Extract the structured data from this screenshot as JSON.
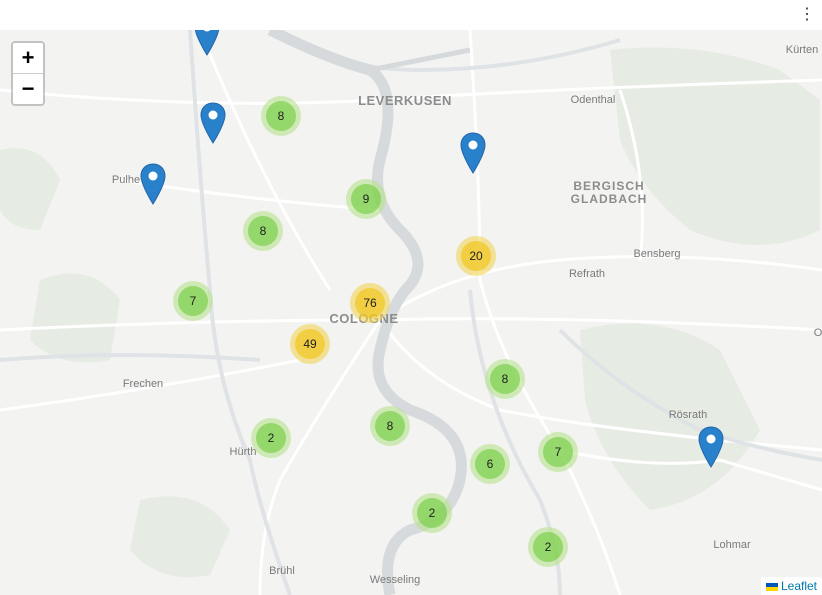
{
  "header": {
    "menu_icon": "vertical-ellipsis-icon",
    "menu_glyph": "⋮"
  },
  "map": {
    "zoom_in": "+",
    "zoom_out": "−",
    "attribution": "Leaflet",
    "places": {
      "leverkusen": "LEVERKUSEN",
      "odenthal": "Odenthal",
      "kurten": "Kürten",
      "bergisch": "BERGISCH",
      "gladbach": "GLADBACH",
      "bensberg": "Bensberg",
      "refrath": "Refrath",
      "pulheim": "Pulhe",
      "cologne": "COLOGNE",
      "frechen": "Frechen",
      "rosrath": "Rösrath",
      "hurth": "Hürth",
      "lohmar": "Lohmar",
      "bruhl": "Brühl",
      "wesseling": "Wesseling",
      "edge_o": "O"
    },
    "clusters": [
      {
        "id": "c1",
        "count": "8"
      },
      {
        "id": "c2",
        "count": "9"
      },
      {
        "id": "c3",
        "count": "8"
      },
      {
        "id": "c4",
        "count": "20"
      },
      {
        "id": "c5",
        "count": "7"
      },
      {
        "id": "c6",
        "count": "76"
      },
      {
        "id": "c7",
        "count": "49"
      },
      {
        "id": "c8",
        "count": "8"
      },
      {
        "id": "c9",
        "count": "2"
      },
      {
        "id": "c10",
        "count": "8"
      },
      {
        "id": "c11",
        "count": "7"
      },
      {
        "id": "c12",
        "count": "6"
      },
      {
        "id": "c13",
        "count": "2"
      },
      {
        "id": "c14",
        "count": "2"
      }
    ],
    "colors": {
      "small_cluster": "#6ecc39",
      "medium_cluster": "#f0c20c",
      "marker": "#2a81cb",
      "river": "#d7dadc",
      "land": "#f3f3f2"
    }
  }
}
